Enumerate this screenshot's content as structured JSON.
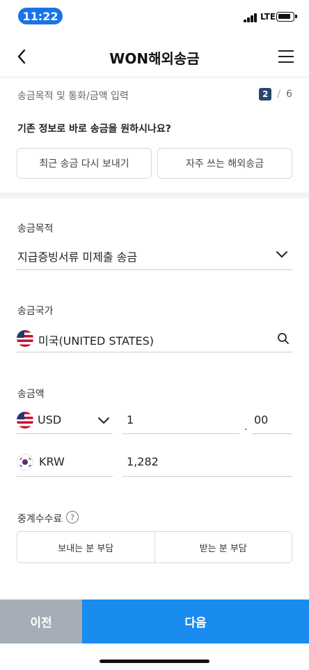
{
  "status_bar": {
    "time": "11:22",
    "network": "LTE"
  },
  "header": {
    "title": "WON해외송금"
  },
  "step": {
    "label": "송금목적 및 통화/금액 입력",
    "current": "2",
    "separator": "/",
    "total": "6"
  },
  "quick": {
    "question": "기존 정보로 바로 송금을 원하시나요?",
    "recent_label": "최근 송금 다시 보내기",
    "frequent_label": "자주 쓰는 해외송금"
  },
  "purpose": {
    "label": "송금목적",
    "value": "지급증빙서류 미제출 송금"
  },
  "country": {
    "label": "송금국가",
    "value": "미국(UNITED STATES)"
  },
  "amount": {
    "label": "송금액",
    "send_currency": "USD",
    "send_integer": "1",
    "decimal_point": ".",
    "send_decimal": "00",
    "receive_currency": "KRW",
    "receive_amount": "1,282"
  },
  "fee": {
    "label": "중계수수료",
    "help": "?",
    "option_sender": "보내는 분 부담",
    "option_receiver": "받는 분 부담"
  },
  "footer": {
    "prev_label": "이전",
    "next_label": "다음"
  },
  "icons": {
    "back": "chevron-left-icon",
    "menu": "hamburger-menu-icon",
    "dropdown": "chevron-down-icon",
    "search": "search-icon",
    "help": "question-circle-icon"
  },
  "colors": {
    "primary": "#1a8cf0",
    "secondary_button": "#a6adb6",
    "step_badge": "#2a4670",
    "time_pill": "#1a73e8"
  }
}
